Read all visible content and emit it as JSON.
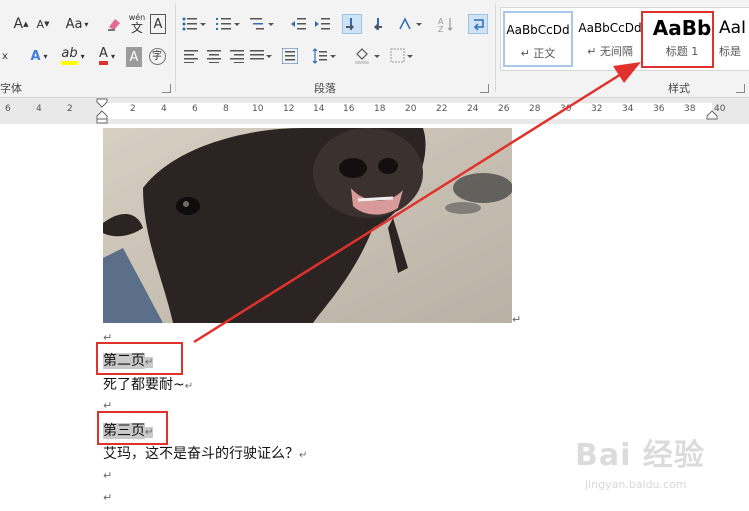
{
  "ribbon": {
    "font_group_label": "字体",
    "paragraph_group_label": "段落",
    "styles_group_label": "样式",
    "font_buttons": {
      "grow": "A",
      "shrink": "A",
      "change_case": "Aa",
      "phonetic_top": "wén",
      "phonetic_bottom": "文",
      "border": "A",
      "text_effect": "A",
      "highlight": "ab",
      "font_color": "A",
      "shading": "A",
      "enclose": "字"
    },
    "styles": [
      {
        "preview": "AaBbCcDd",
        "name": "↵ 正文"
      },
      {
        "preview": "AaBbCcDd",
        "name": "↵ 无间隔"
      },
      {
        "preview": "AaBb",
        "name": "标题 1"
      },
      {
        "preview": "AaI",
        "name": "标是"
      }
    ]
  },
  "ruler": {
    "labels": [
      "6",
      "4",
      "2",
      "2",
      "4",
      "6",
      "8",
      "10",
      "12",
      "14",
      "16",
      "18",
      "20",
      "22",
      "24",
      "26",
      "28",
      "30",
      "32",
      "34",
      "36",
      "38",
      "40"
    ]
  },
  "document": {
    "para_mark": "↵",
    "heading_page2": "第二页",
    "body_page2": "死了都要耐~",
    "heading_page3": "第三页",
    "body_page3": "艾玛，这不是奋斗的行驶证么？"
  },
  "watermark": {
    "text": "Bai 经验",
    "url": "jingyan.baidu.com"
  },
  "colors": {
    "annotation_red": "#e0312d",
    "ribbon_bg": "#f3f3f3",
    "selection_blue": "#cfe3f7",
    "highlight_gray": "#c9c9c9"
  }
}
